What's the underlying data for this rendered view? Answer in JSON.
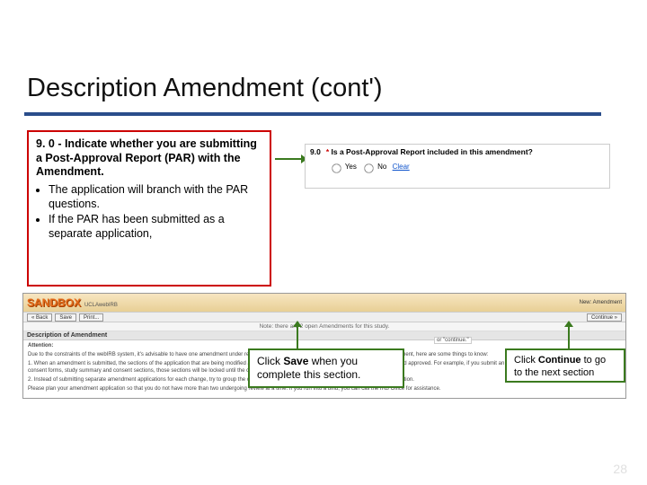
{
  "title": "Description Amendment (cont')",
  "instruction": {
    "heading": "9. 0 - Indicate whether you are submitting a Post-Approval Report  (PAR) with the Amendment.",
    "bullets": [
      "The application will branch with the PAR questions.",
      "If the PAR has been submitted as a separate application,"
    ]
  },
  "form": {
    "number": "9.0",
    "star": "*",
    "question": "Is a Post-Approval Report included in this amendment?",
    "opt_yes": "Yes",
    "opt_no": "No",
    "clear": "Clear"
  },
  "sandbox": {
    "logo": "SANDBOX",
    "sublogo": "UCLAwebIRB",
    "right_label": "New: Amendment",
    "save_btn": "Save",
    "print_btn": "Print...",
    "continue_btn": "Continue »",
    "back_btn": "« Back",
    "note": "Note: there are 2 open Amendments for this study.",
    "section": "Description of Amendment",
    "attention": "Attention:",
    "p1": "Due to the constraints of the webIRB system, it's advisable to have one amendment under review at a time. If, however, you need to submit a second amendment, here are some things to know:",
    "p2": "1. When an amendment is submitted, the sections of the application that are being modified are locked to further changes until the amendment is reviewed and approved. For example, if you submit an amendment that has modifications to the consent forms, study summary and consent sections, those sections will be locked until the changes are reviewed and you receive your approval letter.",
    "p3": "2. Instead of submitting separate amendment applications for each change, try to group the changes together as much as possible on the amendment application.",
    "p4": "Please plan your amendment application so that you do not have more than two undergoing review at a time. If you run into a bind, you can call the IRB Office for assistance."
  },
  "cont_quote": "or  \"continue.\"",
  "callouts": {
    "save_pre": "Click ",
    "save_bold": "Save",
    "save_post": " when you complete this section.",
    "cont_pre": "Click ",
    "cont_bold": "Continue",
    "cont_post": " to go to the next section"
  },
  "page_number": "28"
}
